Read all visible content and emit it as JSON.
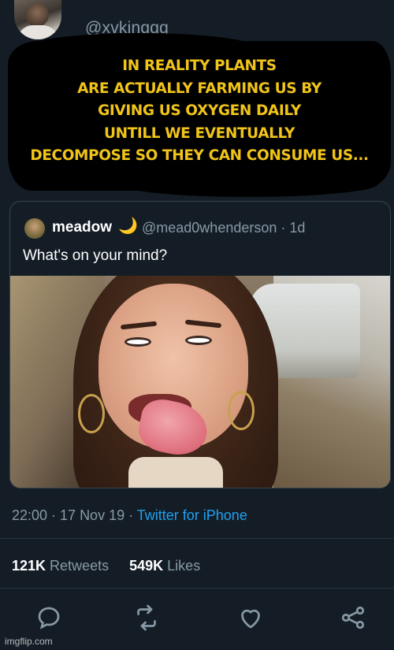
{
  "tweet": {
    "handle": "@xvkinggg",
    "caption_lines": [
      "IN REALITY PLANTS",
      "ARE ACTUALLY FARMING US BY",
      "GIVING US OXYGEN DAILY",
      "UNTILL WE EVENTUALLY",
      "DECOMPOSE SO THEY CAN CONSUME US..."
    ],
    "caption_color": "#f0c419"
  },
  "quoted": {
    "name": "meadow",
    "emoji": "🌙",
    "handle_time": "@mead0whenderson · 1d",
    "text": "What's on your mind?"
  },
  "meta": {
    "datetime": "22:00 · 17 Nov 19 · ",
    "source": "Twitter for iPhone"
  },
  "stats": {
    "retweets_count": "121K",
    "retweets_label": "Retweets",
    "likes_count": "549K",
    "likes_label": "Likes"
  },
  "actions": [
    "reply-icon",
    "retweet-icon",
    "like-icon",
    "share-icon"
  ],
  "watermark": "imgflip.com",
  "colors": {
    "background": "#141d26",
    "link": "#1da1f2",
    "muted": "#8899a6"
  }
}
